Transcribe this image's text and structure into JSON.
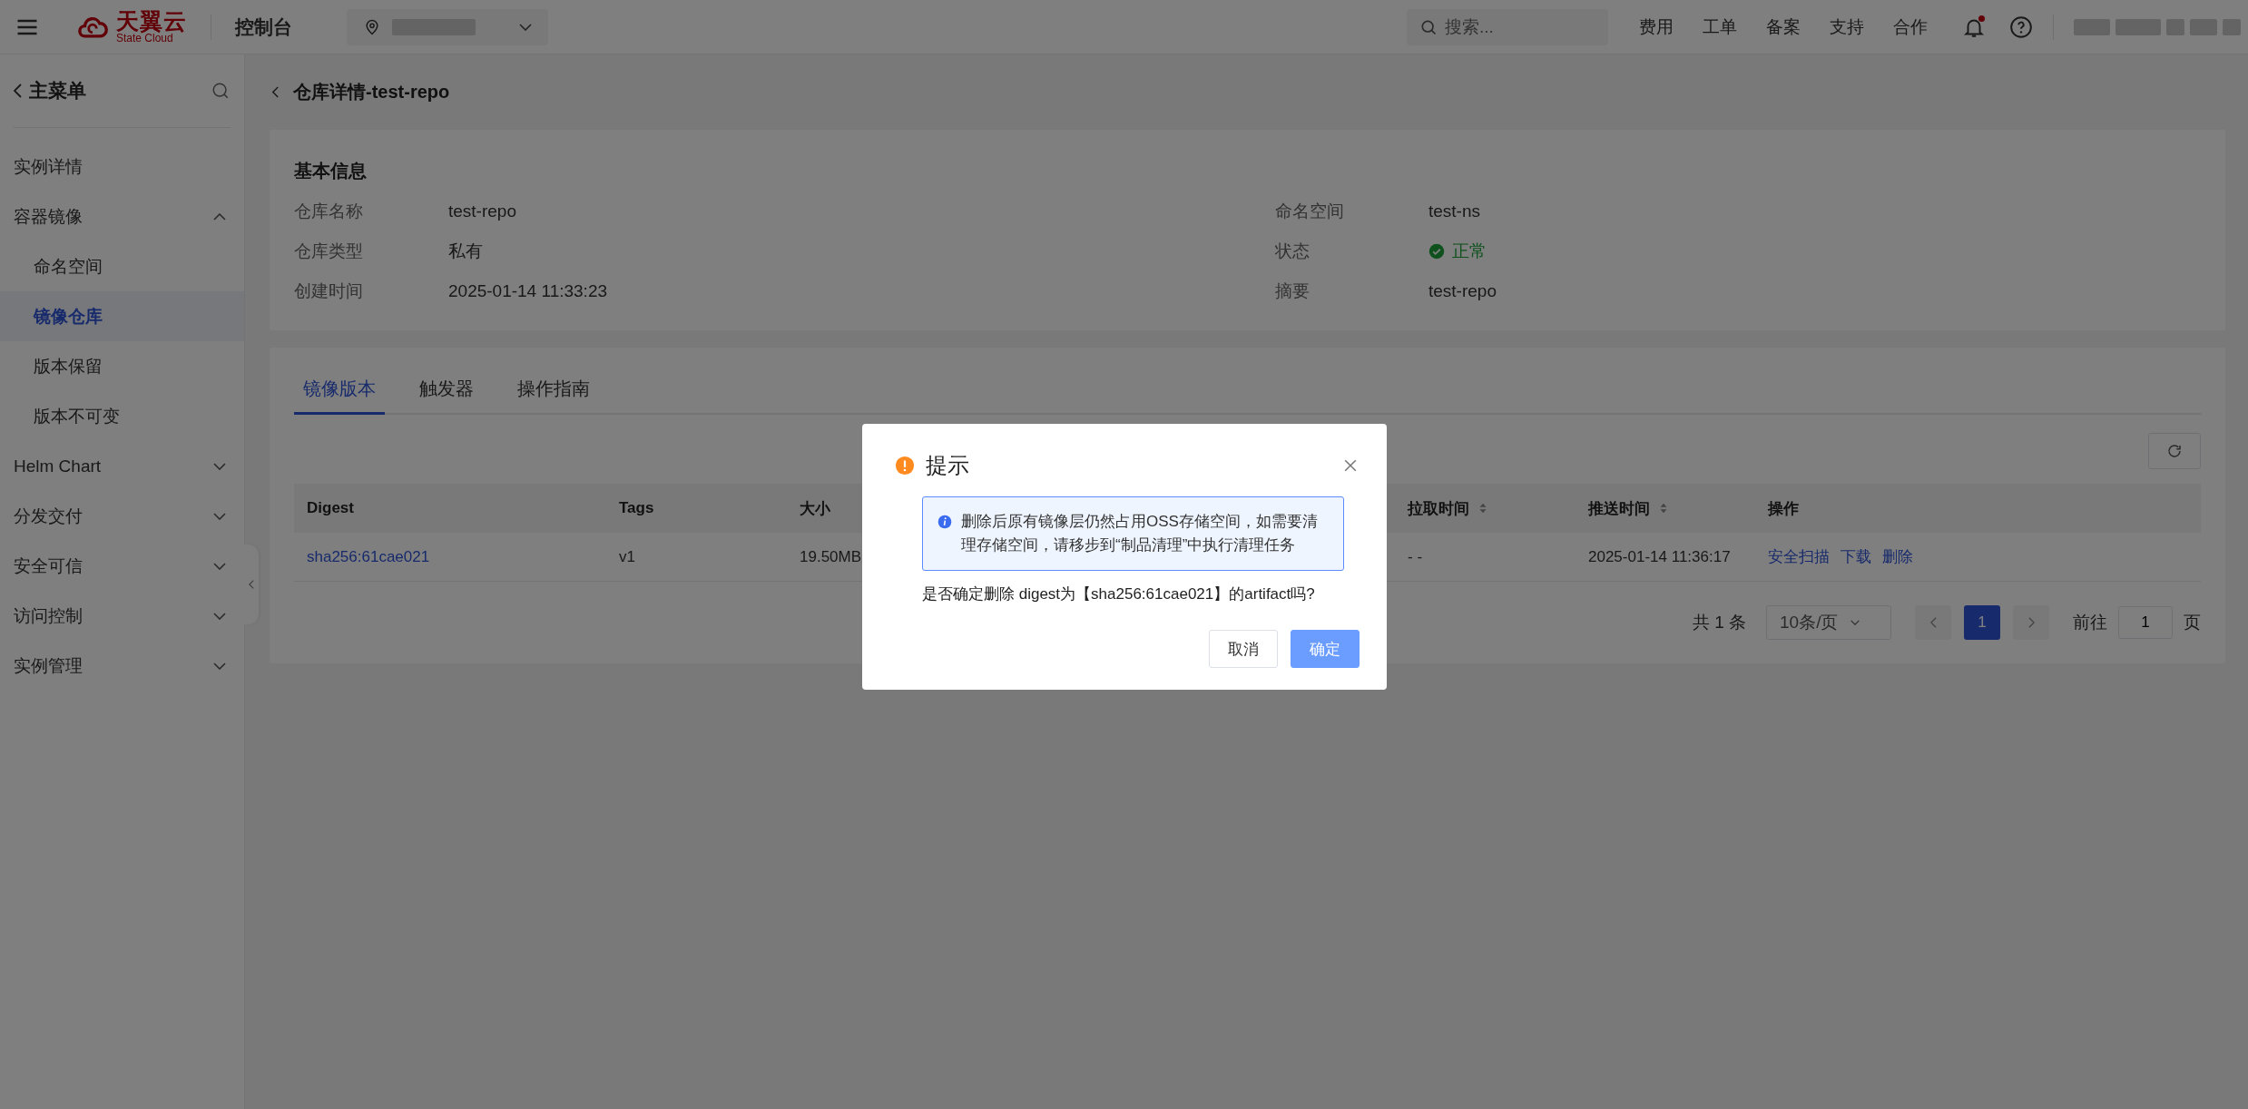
{
  "topbar": {
    "brand": {
      "name": "天翼云",
      "tagline": "State Cloud"
    },
    "console": "控制台",
    "search": {
      "placeholder": "搜索..."
    },
    "nav": [
      "费用",
      "工单",
      "备案",
      "支持",
      "合作"
    ],
    "notifications": {
      "unread": true
    }
  },
  "sidebar": {
    "title": "主菜单",
    "items": [
      {
        "label": "实例详情",
        "kind": "link",
        "selected": false
      },
      {
        "label": "容器镜像",
        "kind": "group",
        "selected": false,
        "expanded": true,
        "children": [
          {
            "label": "命名空间",
            "selected": false
          },
          {
            "label": "镜像仓库",
            "selected": true
          },
          {
            "label": "版本保留",
            "selected": false
          },
          {
            "label": "版本不可变",
            "selected": false
          }
        ]
      },
      {
        "label": "Helm Chart",
        "kind": "group",
        "selected": false,
        "expanded": false
      },
      {
        "label": "分发交付",
        "kind": "group",
        "selected": false,
        "expanded": false
      },
      {
        "label": "安全可信",
        "kind": "group",
        "selected": false,
        "expanded": false
      },
      {
        "label": "访问控制",
        "kind": "group",
        "selected": false,
        "expanded": false
      },
      {
        "label": "实例管理",
        "kind": "group",
        "selected": false,
        "expanded": false
      }
    ]
  },
  "page": {
    "title": "仓库详情-test-repo"
  },
  "basic_info": {
    "title": "基本信息",
    "fields": [
      {
        "label": "仓库名称",
        "value": "test-repo",
        "kind": "text"
      },
      {
        "label": "命名空间",
        "value": "test-ns",
        "kind": "text"
      },
      {
        "label": "仓库类型",
        "value": "私有",
        "kind": "text"
      },
      {
        "label": "状态",
        "value": "正常",
        "kind": "status"
      },
      {
        "label": "创建时间",
        "value": "2025-01-14 11:33:23",
        "kind": "text"
      },
      {
        "label": "摘要",
        "value": "test-repo",
        "kind": "text"
      }
    ]
  },
  "tabs": [
    {
      "label": "镜像版本",
      "selected": true
    },
    {
      "label": "触发器",
      "selected": false
    },
    {
      "label": "操作指南",
      "selected": false
    }
  ],
  "table": {
    "columns": [
      {
        "label": "Digest",
        "sortable": false
      },
      {
        "label": "Tags",
        "sortable": false
      },
      {
        "label": "大小",
        "sortable": false
      },
      {
        "label": "拉取时间",
        "sortable": true
      },
      {
        "label": "推送时间",
        "sortable": true
      },
      {
        "label": "操作",
        "sortable": false
      }
    ],
    "rows": [
      {
        "cells": [
          {
            "text": "sha256:61cae021",
            "kind": "link"
          },
          {
            "text": "v1",
            "kind": "text"
          },
          {
            "text": "19.50MB",
            "kind": "text"
          },
          {
            "text": "- -",
            "kind": "text"
          },
          {
            "text": "2025-01-14 11:36:17",
            "kind": "text"
          }
        ],
        "actions": [
          "安全扫描",
          "下载",
          "删除"
        ]
      }
    ]
  },
  "pagination": {
    "total": "共 1 条",
    "page_size": "10条/页",
    "pages": [
      {
        "label": "1",
        "selected": true
      }
    ],
    "goto_label": "前往",
    "goto_value": "1",
    "goto_suffix": "页"
  },
  "dialog": {
    "title": "提示",
    "alert": "删除后原有镜像层仍然占用OSS存储空间，如需要清理存储空间，请移步到“制品清理”中执行清理任务",
    "message": "是否确定删除 digest为【sha256:61cae021】的artifact吗?",
    "buttons": [
      {
        "label": "取消",
        "kind": "secondary"
      },
      {
        "label": "确定",
        "kind": "primary"
      }
    ]
  }
}
